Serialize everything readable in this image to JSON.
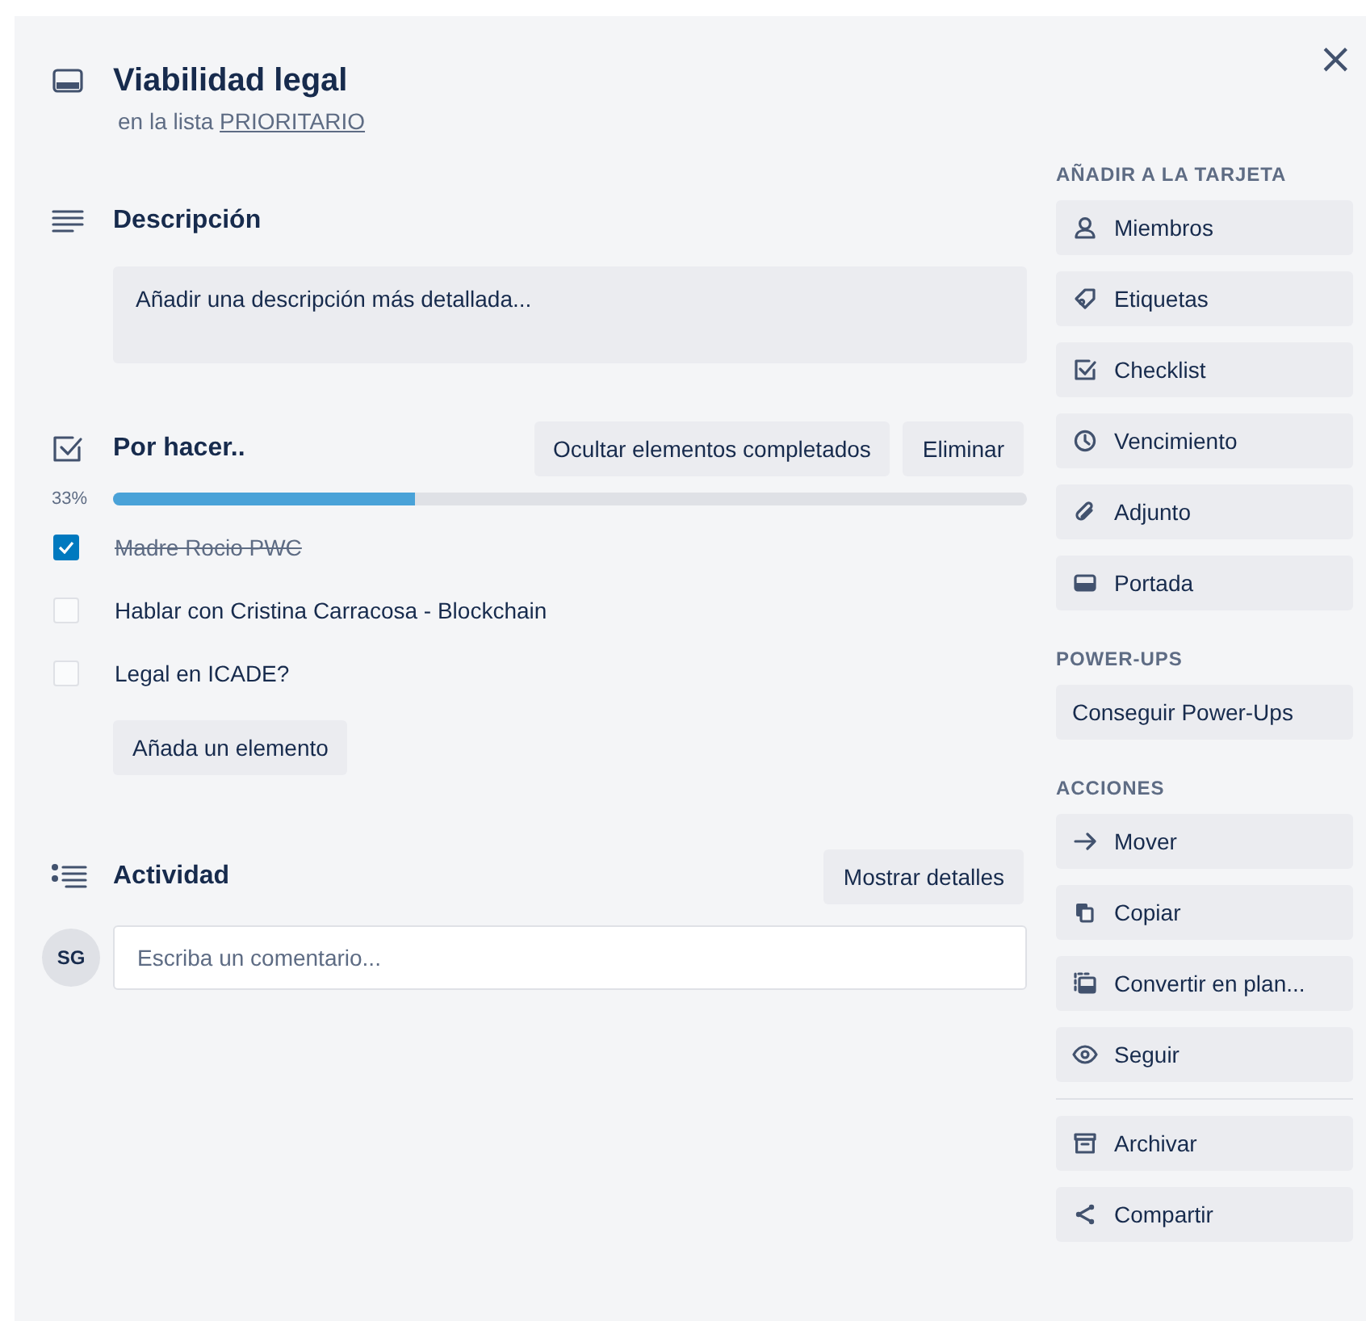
{
  "card": {
    "title": "Viabilidad legal",
    "list_prefix": "en la lista",
    "list_name": "PRIORITARIO",
    "close": "×"
  },
  "description": {
    "heading": "Descripción",
    "placeholder": "Añadir una descripción más detallada..."
  },
  "checklist": {
    "heading": "Por hacer..",
    "buttons": [
      "Ocultar elementos completados",
      "Eliminar"
    ],
    "reading": "33%",
    "level": 0.33,
    "items": [
      {
        "text": "Madre Rocio PWC",
        "checked": true
      },
      {
        "text": "Hablar con Cristina Carracosa - Blockchain",
        "checked": false
      },
      {
        "text": "Legal en ICADE?",
        "checked": false
      }
    ],
    "add_button": "Añada un elemento"
  },
  "activity": {
    "heading": "Actividad",
    "button": "Mostrar detalles",
    "avatar": "SG",
    "placeholder": "Escriba un comentario..."
  },
  "sidebar": {
    "sections": [
      {
        "heading": "AÑADIR A LA TARJETA",
        "groups": [
          [
            "Miembros",
            "Etiquetas",
            "Checklist",
            "Vencimiento",
            "Adjunto",
            "Portada"
          ]
        ]
      },
      {
        "heading": "POWER-UPS",
        "groups": [
          [
            "Conseguir Power-Ups"
          ]
        ]
      },
      {
        "heading": "ACCIONES",
        "groups": [
          [
            "Mover",
            "Copiar",
            "Convertir en plan...",
            "Seguir"
          ],
          [
            "Archivar",
            "Compartir"
          ]
        ]
      }
    ]
  }
}
